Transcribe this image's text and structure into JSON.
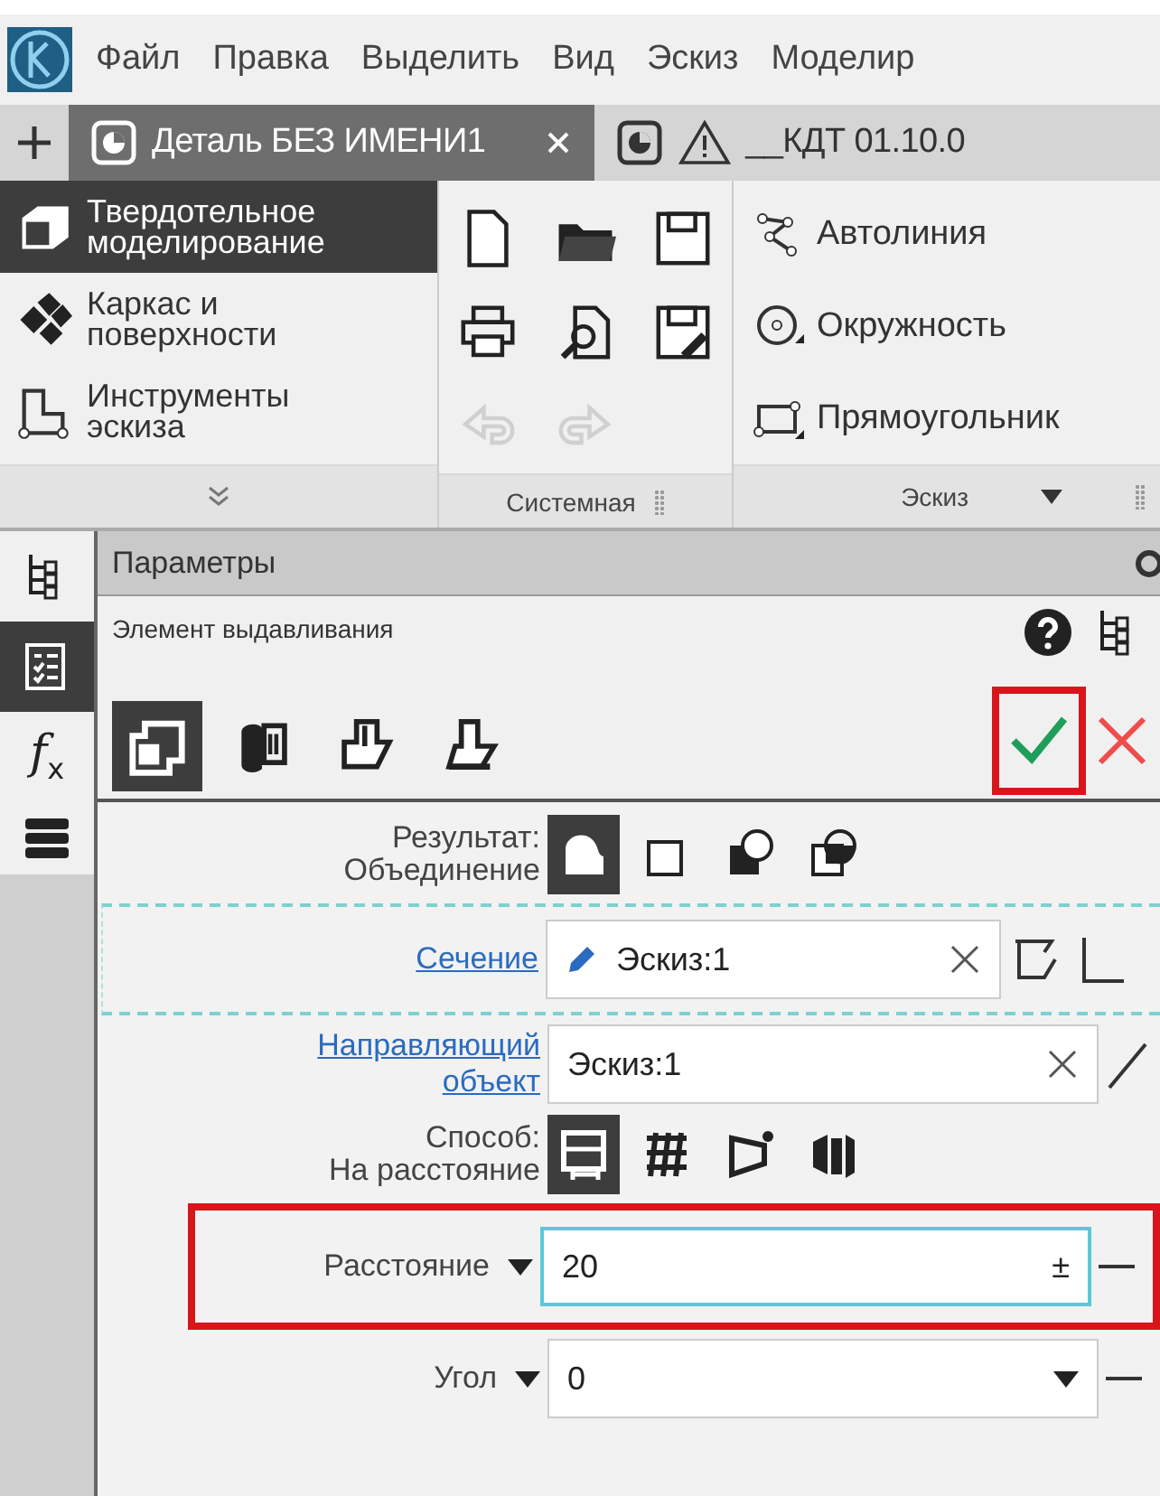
{
  "menu": [
    "Файл",
    "Правка",
    "Выделить",
    "Вид",
    "Эскиз",
    "Моделир"
  ],
  "document_tabs": [
    {
      "title": "Деталь БЕЗ ИМЕНИ1",
      "selected": true,
      "warning": false
    },
    {
      "title": "__КДТ 01.10.0",
      "selected": false,
      "warning": true
    }
  ],
  "ribbon": {
    "modes": [
      {
        "kind": "solid",
        "label": "Твердотельное моделирование",
        "selected": true
      },
      {
        "kind": "surface",
        "label": "Каркас и поверхности",
        "selected": false
      },
      {
        "kind": "sketch",
        "label": "Инструменты эскиза",
        "selected": false
      }
    ],
    "system_group": {
      "title": "Системная",
      "tools": [
        {
          "kind": "new",
          "disabled": false
        },
        {
          "kind": "open",
          "disabled": false
        },
        {
          "kind": "save",
          "disabled": false
        },
        {
          "kind": "print",
          "disabled": false
        },
        {
          "kind": "preview",
          "disabled": false
        },
        {
          "kind": "saveas",
          "disabled": false
        },
        {
          "kind": "undo",
          "disabled": true
        },
        {
          "kind": "redo",
          "disabled": true
        }
      ]
    },
    "sketch_group": {
      "title": "Эскиз",
      "tools": [
        {
          "kind": "autoline",
          "label": "Автолиния"
        },
        {
          "kind": "circle",
          "label": "Окружность"
        },
        {
          "kind": "rect",
          "label": "Прямоугольник"
        }
      ]
    }
  },
  "side_tabs": [
    {
      "kind": "tree",
      "selected": false
    },
    {
      "kind": "params",
      "selected": true
    },
    {
      "kind": "formula",
      "selected": false,
      "label": "f$_{x}$"
    },
    {
      "kind": "layers",
      "selected": false
    }
  ],
  "panel": {
    "title": "Параметры",
    "operation": "Элемент выдавливания",
    "operation_types": [
      {
        "kind": "extrude",
        "selected": true
      },
      {
        "kind": "rotate",
        "selected": false
      },
      {
        "kind": "kinematic",
        "selected": false
      },
      {
        "kind": "loft",
        "selected": false
      }
    ],
    "ok_highlighted": true,
    "result": {
      "label": "Результат:",
      "value": "Объединение",
      "options": [
        {
          "kind": "auto",
          "selected": true
        },
        {
          "kind": "new",
          "selected": false
        },
        {
          "kind": "cut",
          "selected": false
        },
        {
          "kind": "intersect",
          "selected": false
        }
      ]
    },
    "section": {
      "label": "Сечение",
      "value": "Эскиз:1"
    },
    "direction": {
      "label": "Направляющий объект",
      "value": "Эскиз:1"
    },
    "method": {
      "label": "Способ:",
      "value": "На расстояние",
      "options": [
        {
          "kind": "distance",
          "selected": true
        },
        {
          "kind": "through",
          "selected": false
        },
        {
          "kind": "tovertex",
          "selected": false
        },
        {
          "kind": "tosurface",
          "selected": false
        }
      ]
    },
    "distance": {
      "label": "Расстояние",
      "value": "20",
      "adjust_symbol": "±",
      "highlighted": true
    },
    "angle": {
      "label": "Угол",
      "value": "0"
    }
  }
}
